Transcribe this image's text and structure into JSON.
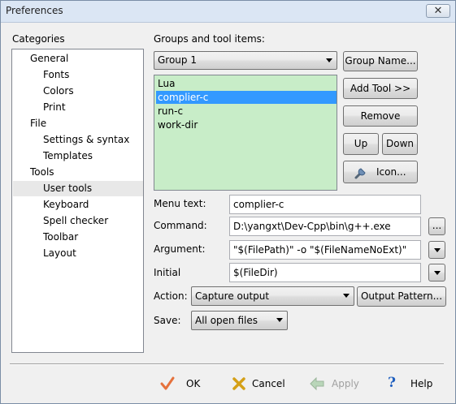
{
  "window": {
    "title": "Preferences",
    "close_label": "✕"
  },
  "categories": {
    "label": "Categories",
    "items": [
      "General",
      "Fonts",
      "Colors",
      "Print",
      "File",
      "Settings & syntax",
      "Templates",
      "Tools",
      "User tools",
      "Keyboard",
      "Spell checker",
      "Toolbar",
      "Layout"
    ],
    "selected": "User tools"
  },
  "groups": {
    "label": "Groups and tool items:",
    "selected_group": "Group 1",
    "tools": [
      "Lua",
      "complier-c",
      "run-c",
      "work-dir"
    ],
    "selected_tool": "complier-c"
  },
  "buttons": {
    "group_name": "Group Name...",
    "add_tool": "Add Tool >>",
    "remove": "Remove",
    "up": "Up",
    "down": "Down",
    "icon": "Icon...",
    "browse": "...",
    "output_pattern": "Output Pattern..."
  },
  "form": {
    "menu_text_label": "Menu text:",
    "menu_text_value": "complier-c",
    "command_label": "Command:",
    "command_value": "D:\\yangxt\\Dev-Cpp\\bin\\g++.exe",
    "argument_label": "Argument:",
    "argument_value": "\"$(FilePath)\" -o \"$(FileNameNoExt)\"",
    "initial_label": "Initial",
    "initial_value": "$(FileDir)",
    "action_label": "Action:",
    "action_value": "Capture output",
    "save_label": "Save:",
    "save_value": "All open files"
  },
  "footer": {
    "ok": "OK",
    "cancel": "Cancel",
    "apply": "Apply",
    "help": "Help"
  },
  "colors": {
    "list_bg": "#c8edc8",
    "selection": "#3399ff",
    "ok_check": "#e5713c",
    "cancel_x": "#d4a017",
    "help": "#1f5fbf"
  }
}
